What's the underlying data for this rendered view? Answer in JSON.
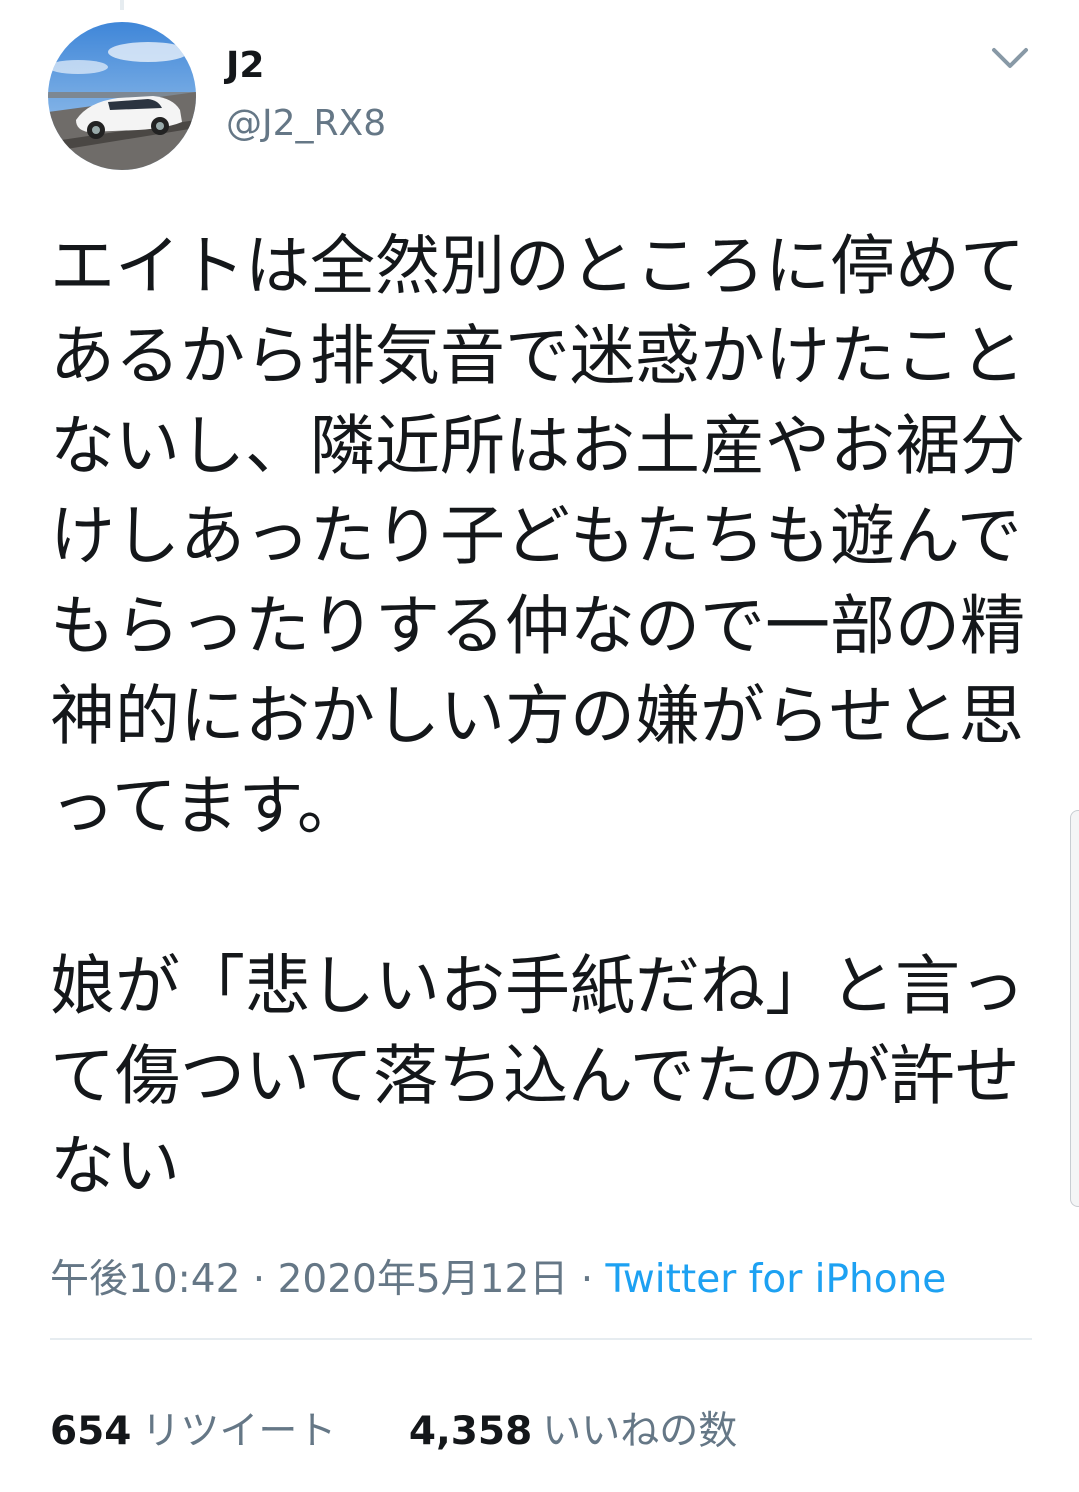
{
  "user": {
    "display_name": "J2",
    "handle": "@J2_RX8",
    "avatar": "avatar-white-sports-car"
  },
  "menu_icon": "chevron-down-icon",
  "tweet": {
    "lines": [
      "エイトは全然別のところに停めて",
      "あるから排気音で迷惑かけたこと",
      "ないし、隣近所はお土産やお裾分",
      "けしあったり子どもたちも遊んで",
      "もらったりする仲なので一部の精",
      "神的におかしい方の嫌がらせと思",
      "ってます。",
      "",
      "娘が「悲しいお手紙だね」と言っ",
      "て傷ついて落ち込んでたのが許せ",
      "ない"
    ]
  },
  "meta": {
    "time": "午後10:42",
    "separator": " · ",
    "date": "2020年5月12日",
    "source": "Twitter for iPhone"
  },
  "stats": {
    "retweets_count": "654",
    "retweets_label": "リツイート",
    "likes_count": "4,358",
    "likes_label": "いいねの数"
  },
  "colors": {
    "text": "#14171a",
    "muted": "#657786",
    "link": "#1da1f2",
    "divider": "#e6ecf0"
  }
}
